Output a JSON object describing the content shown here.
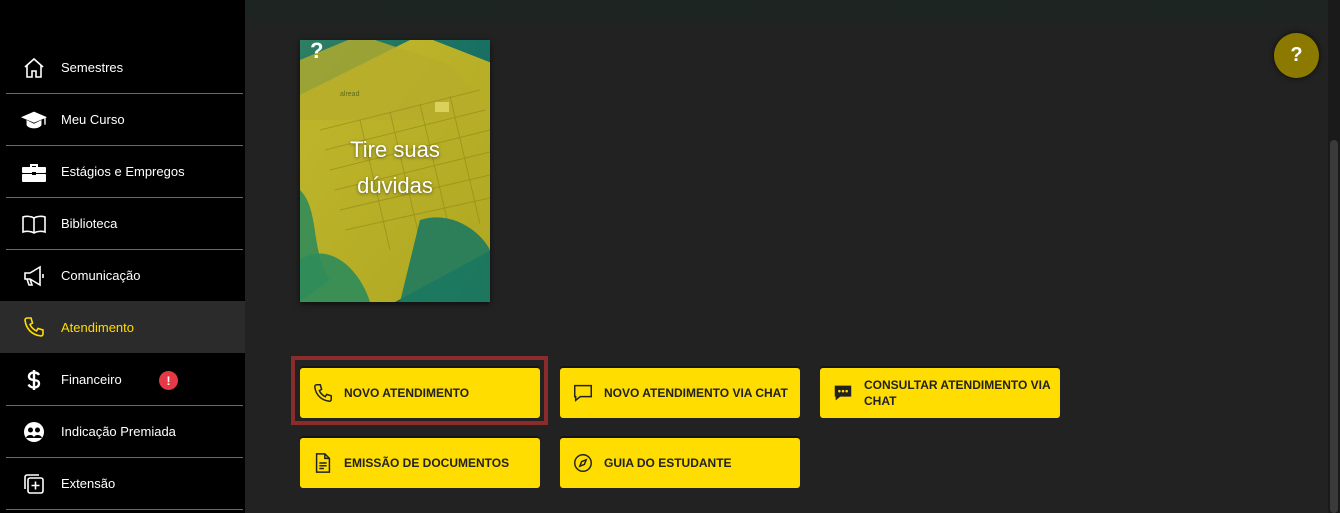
{
  "sidebar": {
    "items": [
      {
        "label": "Semestres",
        "icon": "home-icon"
      },
      {
        "label": "Meu Curso",
        "icon": "graduation-cap-icon"
      },
      {
        "label": "Estágios e Empregos",
        "icon": "briefcase-icon"
      },
      {
        "label": "Biblioteca",
        "icon": "book-icon"
      },
      {
        "label": "Comunicação",
        "icon": "megaphone-icon"
      },
      {
        "label": "Atendimento",
        "icon": "phone-icon",
        "active": true
      },
      {
        "label": "Financeiro",
        "icon": "dollar-icon",
        "badge": "!"
      },
      {
        "label": "Indicação Premiada",
        "icon": "users-icon"
      },
      {
        "label": "Extensão",
        "icon": "add-square-icon"
      }
    ]
  },
  "card": {
    "title_line1": "Tire suas",
    "title_line2": "dúvidas",
    "help_mark": "?"
  },
  "help_button": {
    "label": "?"
  },
  "actions": [
    {
      "label": "Novo atendimento",
      "icon": "phone-icon"
    },
    {
      "label": "Novo atendimento via chat",
      "icon": "chat-bubble-icon"
    },
    {
      "label": "Consultar atendimento via chat",
      "icon": "chat-dots-icon"
    },
    {
      "label": "Emissão de documentos",
      "icon": "document-icon"
    },
    {
      "label": "Guia do estudante",
      "icon": "compass-icon"
    }
  ],
  "colors": {
    "accent": "#ffdd00",
    "sidebar_bg": "#000000",
    "main_bg": "#222222",
    "badge": "#e53946",
    "focus_ring": "#8b2c2c"
  }
}
